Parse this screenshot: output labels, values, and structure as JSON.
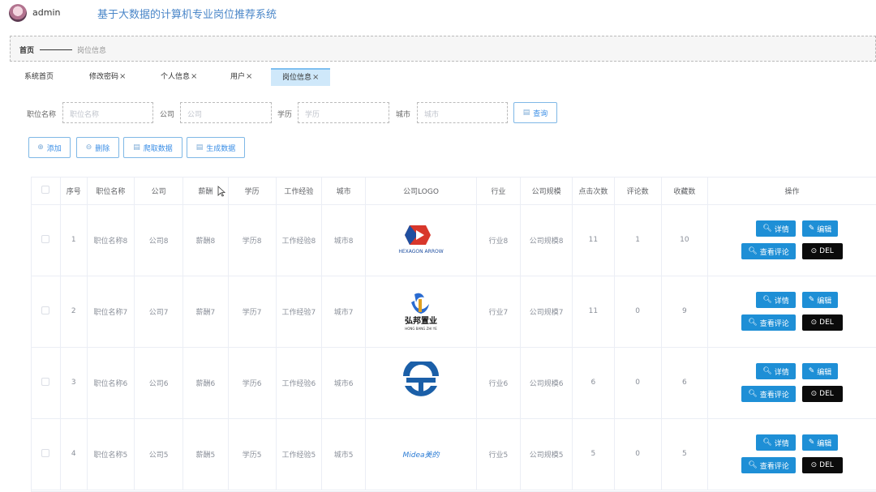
{
  "header": {
    "username": "admin",
    "system_title": "基于大数据的计算机专业岗位推荐系统"
  },
  "breadcrumb": {
    "home": "首页",
    "current": "岗位信息"
  },
  "tabs": [
    {
      "label": "系统首页",
      "closable": false,
      "active": false
    },
    {
      "label": "修改密码",
      "closable": true,
      "active": false
    },
    {
      "label": "个人信息",
      "closable": true,
      "active": false
    },
    {
      "label": "用户",
      "closable": true,
      "active": false
    },
    {
      "label": "岗位信息",
      "closable": true,
      "active": true
    }
  ],
  "close_glyph": "×",
  "search": {
    "job_name_label": "职位名称",
    "job_name_placeholder": "职位名称",
    "company_label": "公司",
    "company_placeholder": "公司",
    "education_label": "学历",
    "education_placeholder": "学历",
    "city_label": "城市",
    "city_placeholder": "城市",
    "query_button": "查询"
  },
  "actions": {
    "add": "添加",
    "delete": "删除",
    "crawl": "爬取数据",
    "generate": "生成数据"
  },
  "table": {
    "headers": [
      "序号",
      "职位名称",
      "公司",
      "薪酬",
      "学历",
      "工作经验",
      "城市",
      "公司LOGO",
      "行业",
      "公司规模",
      "点击次数",
      "评论数",
      "收藏数",
      "操作"
    ],
    "rows": [
      {
        "index": "1",
        "job": "职位名称8",
        "company": "公司8",
        "salary": "薪酬8",
        "education": "学历8",
        "experience": "工作经验8",
        "city": "城市8",
        "logo": "hexagon-arrow-logo",
        "logo_text": "HEXAGON ARROW",
        "industry": "行业8",
        "scale": "公司规模8",
        "clicks": "11",
        "comments": "1",
        "favorites": "10"
      },
      {
        "index": "2",
        "job": "职位名称7",
        "company": "公司7",
        "salary": "薪酬7",
        "education": "学历7",
        "experience": "工作经验7",
        "city": "城市7",
        "logo": "hongbang-logo",
        "logo_text": "弘邦置业",
        "logo_subtext": "HONG BANG ZHI YE",
        "industry": "行业7",
        "scale": "公司规模7",
        "clicks": "11",
        "comments": "0",
        "favorites": "9"
      },
      {
        "index": "3",
        "job": "职位名称6",
        "company": "公司6",
        "salary": "薪酬6",
        "education": "学历6",
        "experience": "工作经验6",
        "city": "城市6",
        "logo": "circle-t-logo",
        "logo_text": "",
        "industry": "行业6",
        "scale": "公司规模6",
        "clicks": "6",
        "comments": "0",
        "favorites": "6"
      },
      {
        "index": "4",
        "job": "职位名称5",
        "company": "公司5",
        "salary": "薪酬5",
        "education": "学历5",
        "experience": "工作经验5",
        "city": "城市5",
        "logo": "midea-logo",
        "logo_text": "Midea美的",
        "industry": "行业5",
        "scale": "公司规模5",
        "clicks": "5",
        "comments": "0",
        "favorites": "5"
      }
    ],
    "row_actions": {
      "detail": "详情",
      "edit": "编辑",
      "view_comments": "查看评论",
      "del": "DEL"
    }
  },
  "colors": {
    "title_blue": "#4a86c8",
    "button_blue": "#1e8fd6",
    "del_black": "#0b0b0b",
    "active_tab": "#cfe8fa"
  }
}
